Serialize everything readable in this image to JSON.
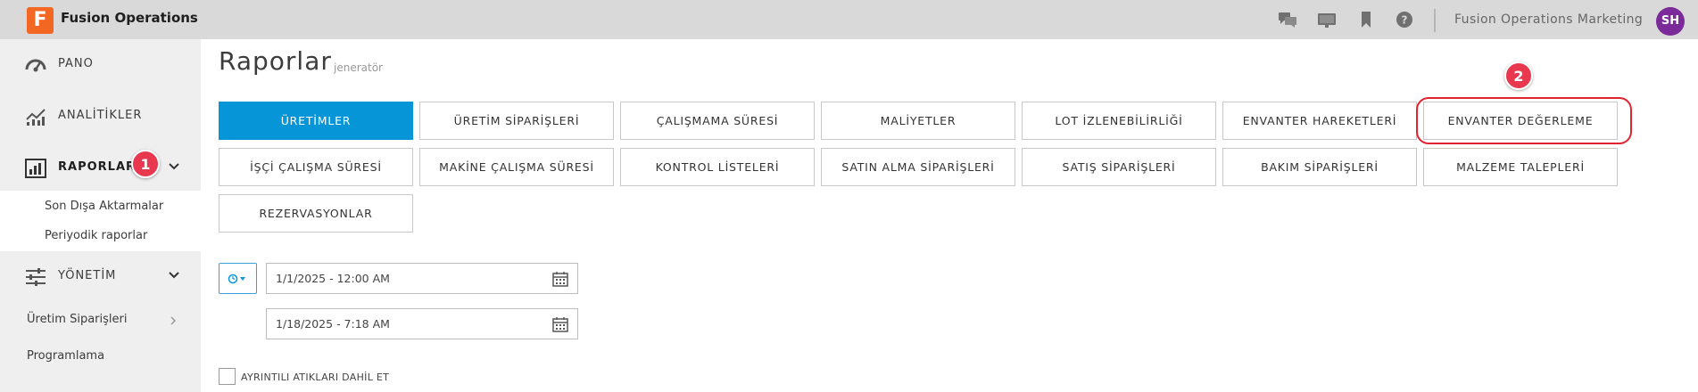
{
  "app": {
    "logo_letter": "F",
    "title": "Fusion Operations",
    "account_name": "Fusion Operations Marketing",
    "avatar_initials": "SH"
  },
  "topbar_icons": [
    "chat-icon",
    "presentation-icon",
    "bookmark-icon",
    "help-icon"
  ],
  "sidebar": {
    "items": [
      {
        "label": "PANO",
        "icon": "dashboard-icon"
      },
      {
        "label": "ANALİTİKLER",
        "icon": "analytics-icon"
      },
      {
        "label": "RAPORLAR",
        "icon": "reports-icon",
        "active": true
      },
      {
        "label": "YÖNETİM",
        "icon": "sliders-icon"
      }
    ],
    "report_subitems": [
      "Son Dışa Aktarmalar",
      "Periyodik raporlar"
    ],
    "management_subitems": [
      "Üretim Siparişleri",
      "Programlama"
    ]
  },
  "annotations": {
    "badge_1": "1",
    "badge_2": "2"
  },
  "main": {
    "title": "Raporlar",
    "subtitle": "jeneratör",
    "report_buttons": [
      "ÜRETİMLER",
      "ÜRETİM SİPARİŞLERİ",
      "ÇALIŞMAMA SÜRESİ",
      "MALİYETLER",
      "LOT İZLENEBİLİRLİĞİ",
      "ENVANTER HAREKETLERİ",
      "ENVANTER DEĞERLEME",
      "İŞÇİ ÇALIŞMA SÜRESİ",
      "MAKİNE ÇALIŞMA SÜRESİ",
      "KONTROL LİSTELERİ",
      "SATIN ALMA SİPARİŞLERİ",
      "SATIŞ SİPARİŞLERİ",
      "BAKIM SİPARİŞLERİ",
      "MALZEME TALEPLERİ",
      "REZERVASYONLAR"
    ],
    "selected_report": "ÜRETİMLER",
    "date_from": "1/1/2025 - 12:00 AM",
    "date_to": "1/18/2025 - 7:18 AM",
    "checkbox_label": "AYRINTILI ATIKLARI DAHİL ET"
  },
  "colors": {
    "accent": "#0696d7",
    "logo": "#f26722",
    "badge": "#e8384f",
    "avatar": "#7b2a9a"
  }
}
